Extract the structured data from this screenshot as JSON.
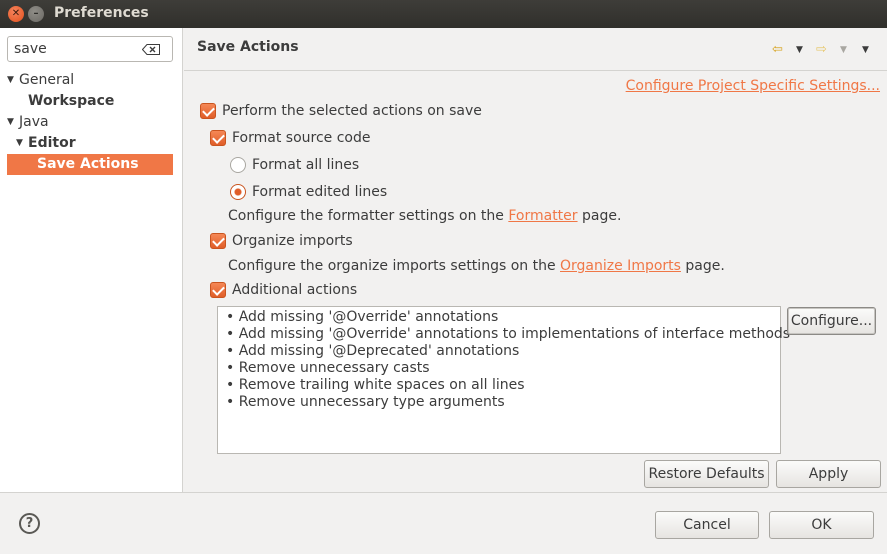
{
  "window": {
    "title": "Preferences"
  },
  "search": {
    "value": "save"
  },
  "tree": {
    "general": "General",
    "workspace": "Workspace",
    "java": "Java",
    "editor": "Editor",
    "save_actions": "Save Actions"
  },
  "page": {
    "title": "Save Actions",
    "configure_project_link": "Configure Project Specific Settings...",
    "perform_label": "Perform the selected actions on save",
    "format_source_label": "Format source code",
    "format_all_label": "Format all lines",
    "format_edited_label": "Format edited lines",
    "formatter_text_pre": "Configure the formatter settings on the ",
    "formatter_link": "Formatter",
    "formatter_text_post": " page.",
    "organize_imports_label": "Organize imports",
    "organize_text_pre": "Configure the organize imports settings on the ",
    "organize_link": "Organize Imports",
    "organize_text_post": " page.",
    "additional_actions_label": "Additional actions",
    "additional_actions": [
      "Add missing '@Override' annotations",
      "Add missing '@Override' annotations to implementations of interface methods",
      "Add missing '@Deprecated' annotations",
      "Remove unnecessary casts",
      "Remove trailing white spaces on all lines",
      "Remove unnecessary type arguments"
    ],
    "configure_button": "Configure...",
    "restore_defaults_button": "Restore Defaults",
    "apply_button": "Apply"
  },
  "footer": {
    "help": "?",
    "cancel_button": "Cancel",
    "ok_button": "OK"
  },
  "state": {
    "perform_checked": true,
    "format_source_checked": true,
    "format_mode": "edited",
    "organize_imports_checked": true,
    "additional_actions_checked": true
  },
  "colors": {
    "accent": "#f07746",
    "selection": "#f07746",
    "titlebar": "#3a3935"
  },
  "icons": {
    "back": "back-arrow-icon",
    "forward": "forward-arrow-icon",
    "menu": "view-menu-icon",
    "clear": "clear-search-icon",
    "help": "help-icon"
  }
}
